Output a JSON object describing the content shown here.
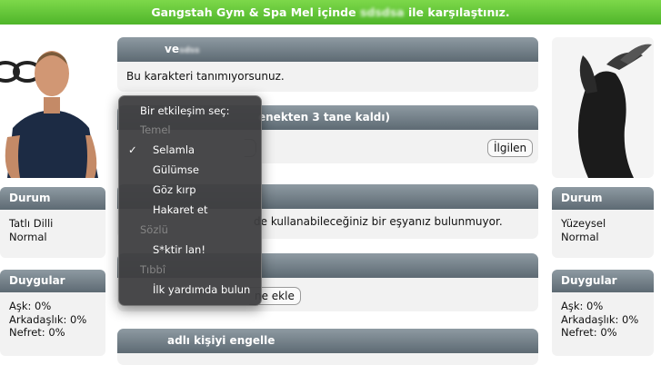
{
  "banner": {
    "prefix": "Gangstah Gym & Spa Mel içinde",
    "blurred": "sdsdsa",
    "suffix": "ile karşılaştınız."
  },
  "left": {
    "status_title": "Durum",
    "status_lines": [
      "Tatlı Dilli",
      "Normal"
    ],
    "feelings_title": "Duygular",
    "feelings": [
      "Aşk: 0%",
      "Arkadaşlık: 0%",
      "Nefret: 0%"
    ]
  },
  "right": {
    "status_title": "Durum",
    "status_lines": [
      "Yüzeysel",
      "Normal"
    ],
    "feelings_title": "Duygular",
    "feelings": [
      "Aşk: 0%",
      "Arkadaşlık: 0%",
      "Nefret: 0%"
    ]
  },
  "panel1": {
    "title": "ve",
    "title_blurred": "sdss",
    "body": "Bu karakteri tanımıyorsunuz."
  },
  "panel2": {
    "title_visible": "enekten 3 tane kaldı)",
    "button": "İlgilen"
  },
  "panel3": {
    "body_visible": "de kullanabileceğiniz bir eşyanız bulunmuyor."
  },
  "panel4": {
    "button_visible": "ne ekle"
  },
  "panel5": {
    "title": "adlı kişiyi engelle"
  },
  "menu": {
    "heading": "Bir etkileşim seç:",
    "groups": [
      {
        "label": "Temel",
        "items": [
          {
            "label": "Selamla",
            "checked": true
          },
          {
            "label": "Gülümse",
            "checked": false
          },
          {
            "label": "Göz kırp",
            "checked": false
          },
          {
            "label": "Hakaret et",
            "checked": false
          }
        ]
      },
      {
        "label": "Sözlü",
        "items": [
          {
            "label": "S*ktir lan!",
            "checked": false
          }
        ]
      },
      {
        "label": "Tıbbî",
        "items": [
          {
            "label": "İlk yardımda bulun",
            "checked": false
          }
        ]
      }
    ],
    "check_glyph": "✓"
  }
}
